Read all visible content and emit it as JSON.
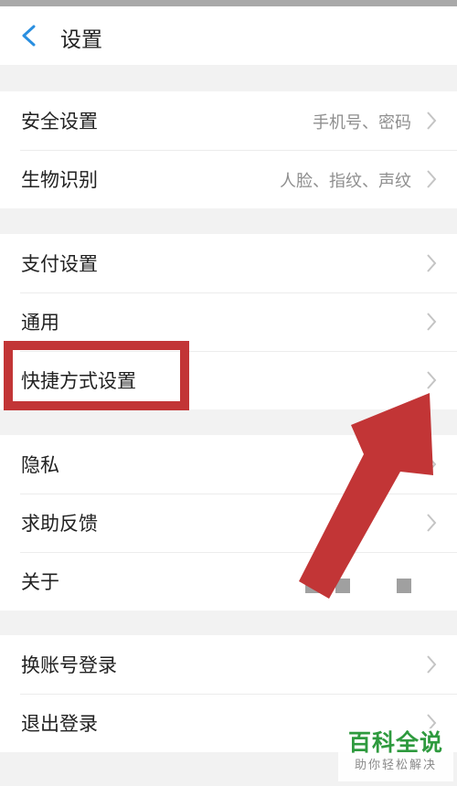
{
  "header": {
    "title": "设置",
    "back_icon": "back-chevron-icon"
  },
  "groups": [
    {
      "items": [
        {
          "label": "安全设置",
          "value": "手机号、密码"
        },
        {
          "label": "生物识别",
          "value": "人脸、指纹、声纹"
        }
      ]
    },
    {
      "items": [
        {
          "label": "支付设置",
          "value": ""
        },
        {
          "label": "通用",
          "value": ""
        },
        {
          "label": "快捷方式设置",
          "value": ""
        }
      ]
    },
    {
      "items": [
        {
          "label": "隐私",
          "value": ""
        },
        {
          "label": "求助反馈",
          "value": ""
        },
        {
          "label": "关于",
          "value": ""
        }
      ]
    },
    {
      "items": [
        {
          "label": "换账号登录",
          "value": ""
        },
        {
          "label": "退出登录",
          "value": ""
        }
      ]
    }
  ],
  "annotation": {
    "highlight_color": "#c23536",
    "highlighted_item": "快捷方式设置"
  },
  "watermark": {
    "title": "百科全说",
    "subtitle": "助你轻松解决",
    "color": "#2e9a3e"
  }
}
